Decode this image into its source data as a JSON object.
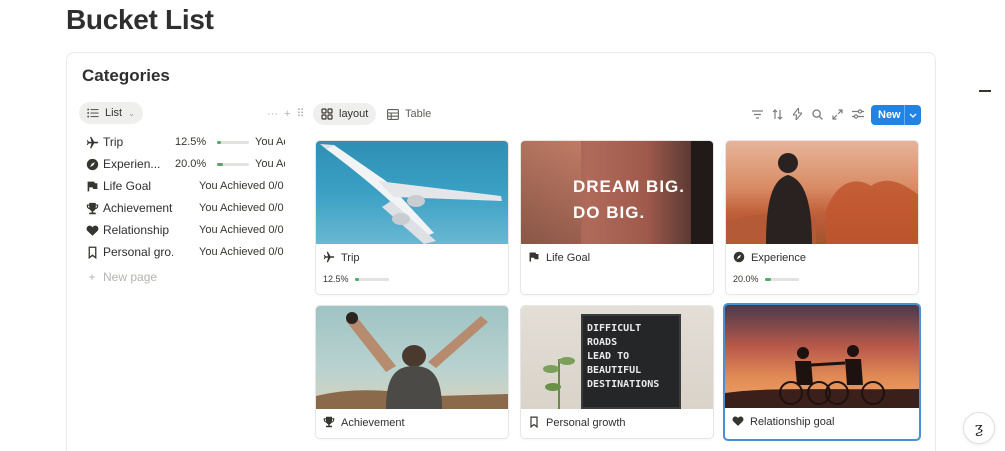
{
  "page": {
    "title": "Bucket List"
  },
  "section": {
    "title": "Categories"
  },
  "list_view": {
    "view_label": "List",
    "rows": [
      {
        "name": "Trip",
        "icon": "airplane-icon",
        "percent": "12.5%",
        "progress": 0.125,
        "achieved": "You Ac"
      },
      {
        "name": "Experien...",
        "icon": "compass-icon",
        "percent": "20.0%",
        "progress": 0.2,
        "achieved": "You Ac"
      },
      {
        "name": "Life Goal",
        "icon": "flag-icon",
        "achieved": "You Achieved 0/0"
      },
      {
        "name": "Achievement",
        "icon": "trophy-icon",
        "achieved": "You Achieved 0/0"
      },
      {
        "name": "Relationship ...",
        "icon": "heart-icon",
        "achieved": "You Achieved 0/0"
      },
      {
        "name": "Personal gro...",
        "icon": "bookmark-icon",
        "achieved": "You Achieved 0/0"
      }
    ],
    "new_page_label": "New page"
  },
  "gallery_view": {
    "tabs": [
      {
        "label": "layout",
        "icon": "gallery-icon",
        "active": true
      },
      {
        "label": "Table",
        "icon": "table-icon",
        "active": false
      }
    ],
    "toolbar_icons": [
      "filter-icon",
      "sort-icon",
      "lightning-icon",
      "search-icon",
      "expand-icon",
      "settings-icon"
    ],
    "new_button_label": "New",
    "cards": [
      {
        "title": "Trip",
        "icon": "airplane-icon",
        "cover": "airplane-photo",
        "percent": "12.5%",
        "progress": 0.125
      },
      {
        "title": "Life Goal",
        "icon": "flag-icon",
        "cover": "dream-big-photo",
        "cover_text": [
          "DREAM BIG.",
          "DO BIG."
        ]
      },
      {
        "title": "Experience",
        "icon": "compass-icon",
        "cover": "desert-photo",
        "percent": "20.0%",
        "progress": 0.2
      },
      {
        "title": "Achievement",
        "icon": "trophy-icon",
        "cover": "raised-arms-photo"
      },
      {
        "title": "Personal growth",
        "icon": "bookmark-icon",
        "cover": "letterboard-photo",
        "cover_text": [
          "DIFFICULT",
          "ROADS",
          "LEAD TO",
          "BEAUTIFUL",
          "DESTINATIONS"
        ]
      },
      {
        "title": "Relationship goal",
        "icon": "heart-icon",
        "cover": "sunset-bikes-photo",
        "selected": true
      }
    ]
  },
  "colors": {
    "accent": "#2383e2",
    "progress": "#4dab6d",
    "selection": "#4a8fd4"
  }
}
